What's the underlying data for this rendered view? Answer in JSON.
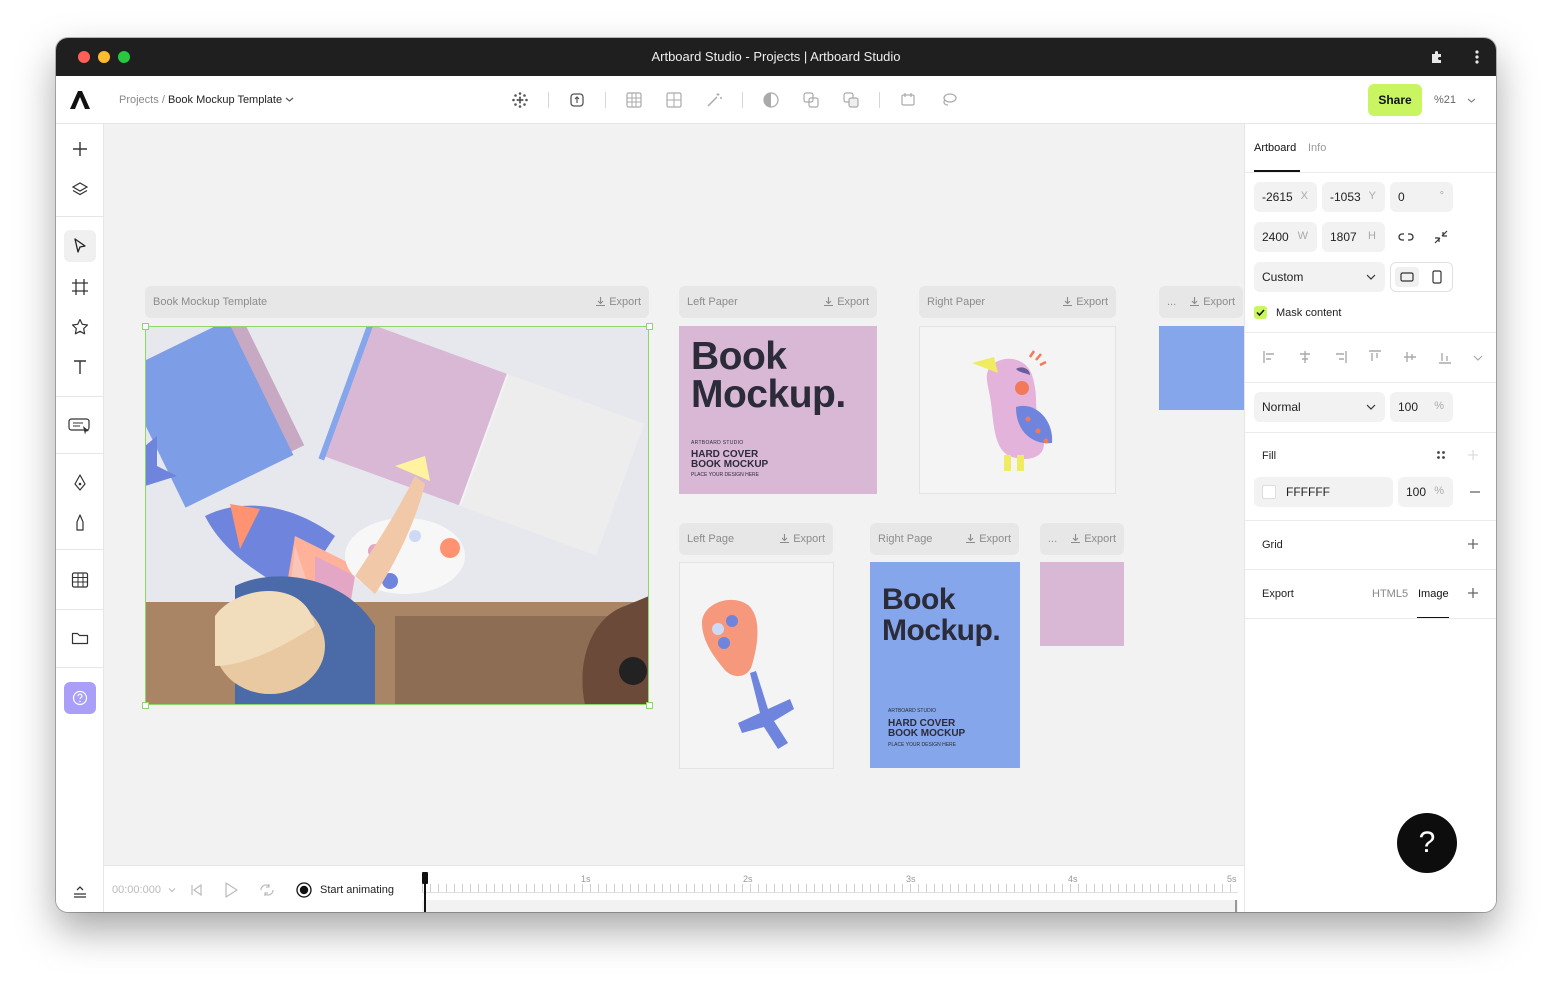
{
  "window": {
    "title": "Artboard Studio - Projects | Artboard Studio"
  },
  "toolbar": {
    "breadcrumb_parent": "Projects",
    "breadcrumb_sep": "/",
    "breadcrumb_current": "Book Mockup Template",
    "share_label": "Share",
    "zoom_label": "%21",
    "icons": [
      "shape-dots-icon",
      "shape-swap-icon",
      "grid-icon",
      "mesh-icon",
      "magic-wand-icon",
      "half-circle-icon",
      "union-icon",
      "subtract-icon",
      "frame-tool-icon",
      "lasso-icon"
    ]
  },
  "artboards": [
    {
      "name": "Book Mockup Template",
      "export": "Export"
    },
    {
      "name": "Left Paper",
      "export": "Export"
    },
    {
      "name": "Right Paper",
      "export": "Export"
    },
    {
      "name": "...",
      "export": "Export"
    },
    {
      "name": "Left Page",
      "export": "Export"
    },
    {
      "name": "Right Page",
      "export": "Export"
    },
    {
      "name": "...",
      "export": "Export"
    }
  ],
  "book": {
    "title_line1": "Book",
    "title_line2": "Mockup.",
    "studio": "ARTBOARD STUDIO",
    "sub_line1": "HARD COVER",
    "sub_line2": "BOOK MOCKUP",
    "tagline": "PLACE YOUR DESIGN HERE"
  },
  "colors": {
    "accent": "#c8f560",
    "pink": "#d9b8d6",
    "blue": "#85a6ea",
    "selection": "#8fd66a"
  },
  "timeline": {
    "time": "00:00:000",
    "start_label": "Start animating",
    "ticks": [
      "1s",
      "2s",
      "3s",
      "4s",
      "5s"
    ]
  },
  "panel": {
    "tabs": [
      "Artboard",
      "Info"
    ],
    "x": {
      "value": "-2615",
      "unit": "X"
    },
    "y": {
      "value": "-1053",
      "unit": "Y"
    },
    "rotation": {
      "value": "0",
      "unit": "°"
    },
    "w": {
      "value": "2400",
      "unit": "W"
    },
    "h": {
      "value": "1807",
      "unit": "H"
    },
    "preset": "Custom",
    "mask_label": "Mask content",
    "blend_mode": "Normal",
    "opacity": {
      "value": "100",
      "unit": "%"
    },
    "fill_label": "Fill",
    "fill_hex": "FFFFFF",
    "fill_opacity": {
      "value": "100",
      "unit": "%"
    },
    "grid_label": "Grid",
    "export_label": "Export",
    "export_tabs": [
      "HTML5",
      "Image"
    ]
  },
  "help": {
    "label": "?"
  }
}
